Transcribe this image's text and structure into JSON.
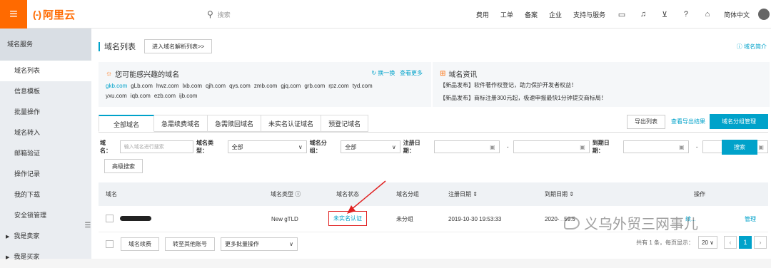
{
  "header": {
    "brand": "阿里云",
    "brand_mark": "(-)",
    "search_placeholder": "搜索",
    "nav": [
      "费用",
      "工单",
      "备案",
      "企业",
      "支持与服务"
    ],
    "language": "简体中文",
    "icons": [
      "terminal-icon",
      "bell-icon",
      "cart-icon",
      "help-icon",
      "home-icon"
    ]
  },
  "sidebar": {
    "title": "域名服务",
    "items": [
      "域名列表",
      "信息模板",
      "批量操作",
      "域名转入",
      "邮箱验证",
      "操作记录",
      "我的下载",
      "安全锁管理"
    ],
    "groups": [
      "我是卖家",
      "我是买家"
    ],
    "active_index": 0
  },
  "page": {
    "title": "域名列表",
    "dns_button": "进入域名解析列表>>",
    "intro_link": "域名简介"
  },
  "interest": {
    "title": "您可能感兴趣的域名",
    "refresh": "换一换",
    "more": "查看更多",
    "domains": [
      "gkb.com",
      "gLb.com",
      "hwz.com",
      "lxb.com",
      "qjh.com",
      "qys.com",
      "zmb.com",
      "gjq.com",
      "grb.com",
      "rpz.com",
      "tyd.com",
      "yxu.com",
      "iqb.com",
      "ezb.com",
      "ijb.com"
    ]
  },
  "news": {
    "title": "域名资讯",
    "items": [
      "【新品发布】软件著作权登记，助力保护开发者权益！",
      "【新品发布】商标注册300元起，极速申报最快1分钟提交商标局！"
    ]
  },
  "tabs": [
    "全部域名",
    "急需续费域名",
    "急需赎回域名",
    "未实名认证域名",
    "预登记域名"
  ],
  "tab_actions": {
    "export": "导出列表",
    "view_export": "查看导出结果",
    "group_manage": "域名分组管理"
  },
  "filters": {
    "domain_label": "域名：",
    "domain_placeholder": "输入域名进行搜索",
    "type_label": "域名类型：",
    "type_value": "全部",
    "group_label": "域名分组：",
    "group_value": "全部",
    "reg_label": "注册日期：",
    "exp_label": "到期日期：",
    "dash": "-",
    "search": "搜索",
    "advanced": "高级搜索"
  },
  "table": {
    "headers": [
      "域名",
      "域名类型",
      "域名状态",
      "域名分组",
      "注册日期",
      "到期日期",
      "操作"
    ],
    "rows": [
      {
        "type": "New gTLD",
        "status": "未实名认证",
        "group": "未分组",
        "reg_date": "2019-10-30 19:53:33",
        "exp_date_prefix": "2020-",
        "exp_date_suffix": "59:5",
        "ops_partial": "续...",
        "ops_manage": "管理"
      }
    ]
  },
  "footer": {
    "renew": "域名续费",
    "transfer": "转至其他账号",
    "batch": "更多批量操作",
    "total": "共有 1 条，每页显示：",
    "page_size": "20",
    "current_page": "1"
  },
  "watermark": "义乌外贸三网事儿",
  "colors": {
    "brand": "#ff6a00",
    "accent": "#00a2ca",
    "highlight_box": "#e02020"
  }
}
